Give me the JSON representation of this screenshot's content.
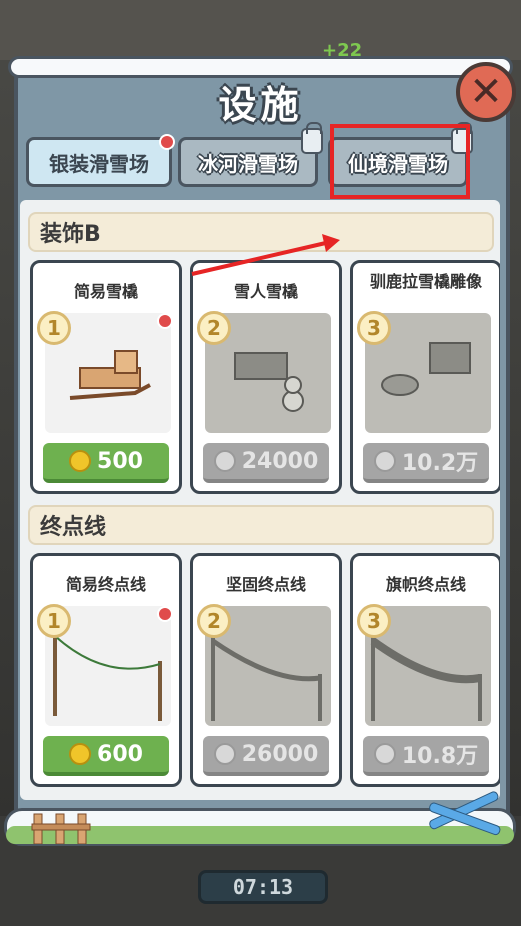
{
  "popup": {
    "title": "设施",
    "close_icon": "close-icon"
  },
  "hud": {
    "plus_value": "+22",
    "timer": "07:13"
  },
  "tabs": [
    {
      "label": "银装滑雪场",
      "state": "active",
      "badge": "red-dot"
    },
    {
      "label": "冰河滑雪场",
      "state": "locked",
      "icon": "lock-icon"
    },
    {
      "label": "仙境滑雪场",
      "state": "locked",
      "icon": "lock-icon",
      "highlighted": true
    }
  ],
  "sections": [
    {
      "title": "装饰B",
      "items": [
        {
          "num": "1",
          "name": "简易雪橇",
          "price": "500",
          "currency": "coin",
          "unlocked": true,
          "red_dot": true
        },
        {
          "num": "2",
          "name": "雪人雪橇",
          "price": "24000",
          "currency": "coin",
          "unlocked": false
        },
        {
          "num": "3",
          "name": "驯鹿拉雪橇雕像",
          "price": "10.2万",
          "currency": "coin",
          "unlocked": false
        }
      ]
    },
    {
      "title": "终点线",
      "items": [
        {
          "num": "1",
          "name": "简易终点线",
          "price": "600",
          "currency": "coin",
          "unlocked": true,
          "red_dot": true
        },
        {
          "num": "2",
          "name": "坚固终点线",
          "price": "26000",
          "currency": "coin",
          "unlocked": false
        },
        {
          "num": "3",
          "name": "旗帜终点线",
          "price": "10.8万",
          "currency": "coin",
          "unlocked": false
        }
      ]
    }
  ],
  "colors": {
    "panel": "#7f97a6",
    "highlight": "#e62525",
    "price_green": "#6eb14f",
    "price_gray": "#a5a5a5"
  }
}
